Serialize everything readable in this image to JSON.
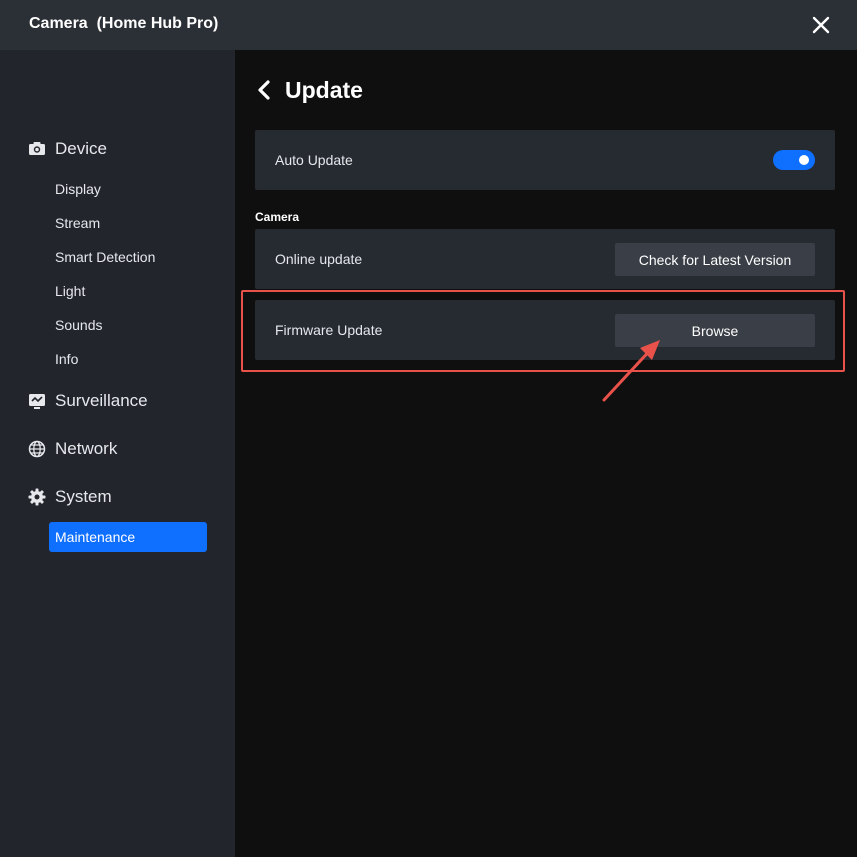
{
  "window": {
    "title": "Camera  (Home Hub Pro)",
    "close_icon": "close-icon"
  },
  "sidebar": {
    "groups": [
      {
        "label": "Device",
        "icon": "camera-icon"
      },
      {
        "label": "Surveillance",
        "icon": "monitor-icon"
      },
      {
        "label": "Network",
        "icon": "globe-icon"
      },
      {
        "label": "System",
        "icon": "gear-icon"
      }
    ],
    "device_items": [
      "Display",
      "Stream",
      "Smart Detection",
      "Light",
      "Sounds",
      "Info"
    ],
    "system_items": [
      "Maintenance"
    ],
    "active_item": "Maintenance"
  },
  "main": {
    "title": "Update",
    "auto_update": {
      "label": "Auto Update",
      "enabled": true
    },
    "section_label": "Camera",
    "online_update": {
      "label": "Online update",
      "button": "Check for Latest Version"
    },
    "firmware_update": {
      "label": "Firmware Update",
      "button": "Browse"
    }
  },
  "colors": {
    "accent": "#0f6fff",
    "annotation": "#e8524a",
    "sidebar_bg": "#22252c",
    "card_bg": "#262a31"
  }
}
